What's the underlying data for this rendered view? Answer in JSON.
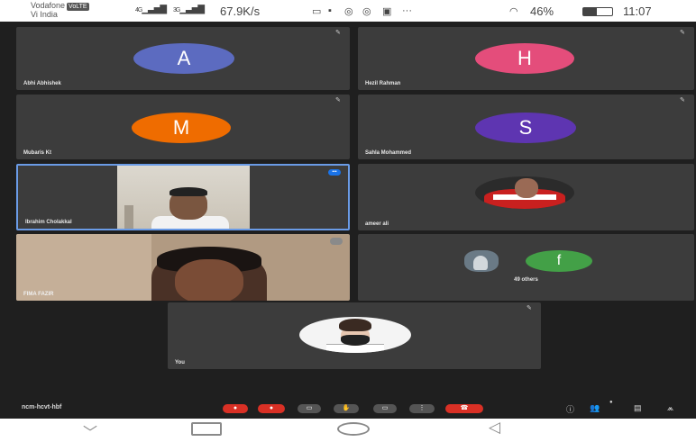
{
  "status_bar": {
    "carrier_line1": "Vodafone",
    "volte": "VoLTE",
    "carrier_line2": "Vi India",
    "sig1": "4G",
    "sig2": "3G",
    "net_speed": "67.9K/s",
    "battery": "46%",
    "battery_level": 0.46,
    "time": "11:07"
  },
  "participants": [
    {
      "name": "Abhi Abhishek",
      "initial": "A",
      "color": "#5c6bc0"
    },
    {
      "name": "Hezil Rahman",
      "initial": "H",
      "color": "#e44d7b"
    },
    {
      "name": "Mubaris Kt",
      "initial": "M",
      "color": "#ef6c00"
    },
    {
      "name": "Sahla Mohammed",
      "initial": "S",
      "color": "#5e35b1"
    },
    {
      "name": "Ibrahim Cholakkal"
    },
    {
      "name": "ameer ali"
    },
    {
      "name": "FIMA FAZIR"
    },
    {
      "initial": "f",
      "color": "#43a047",
      "others_label": "49 others"
    },
    {
      "name": "You"
    }
  ],
  "controls": {
    "meeting_code": "ncm-hcvt-hbf"
  },
  "accent": "#6a9be6"
}
